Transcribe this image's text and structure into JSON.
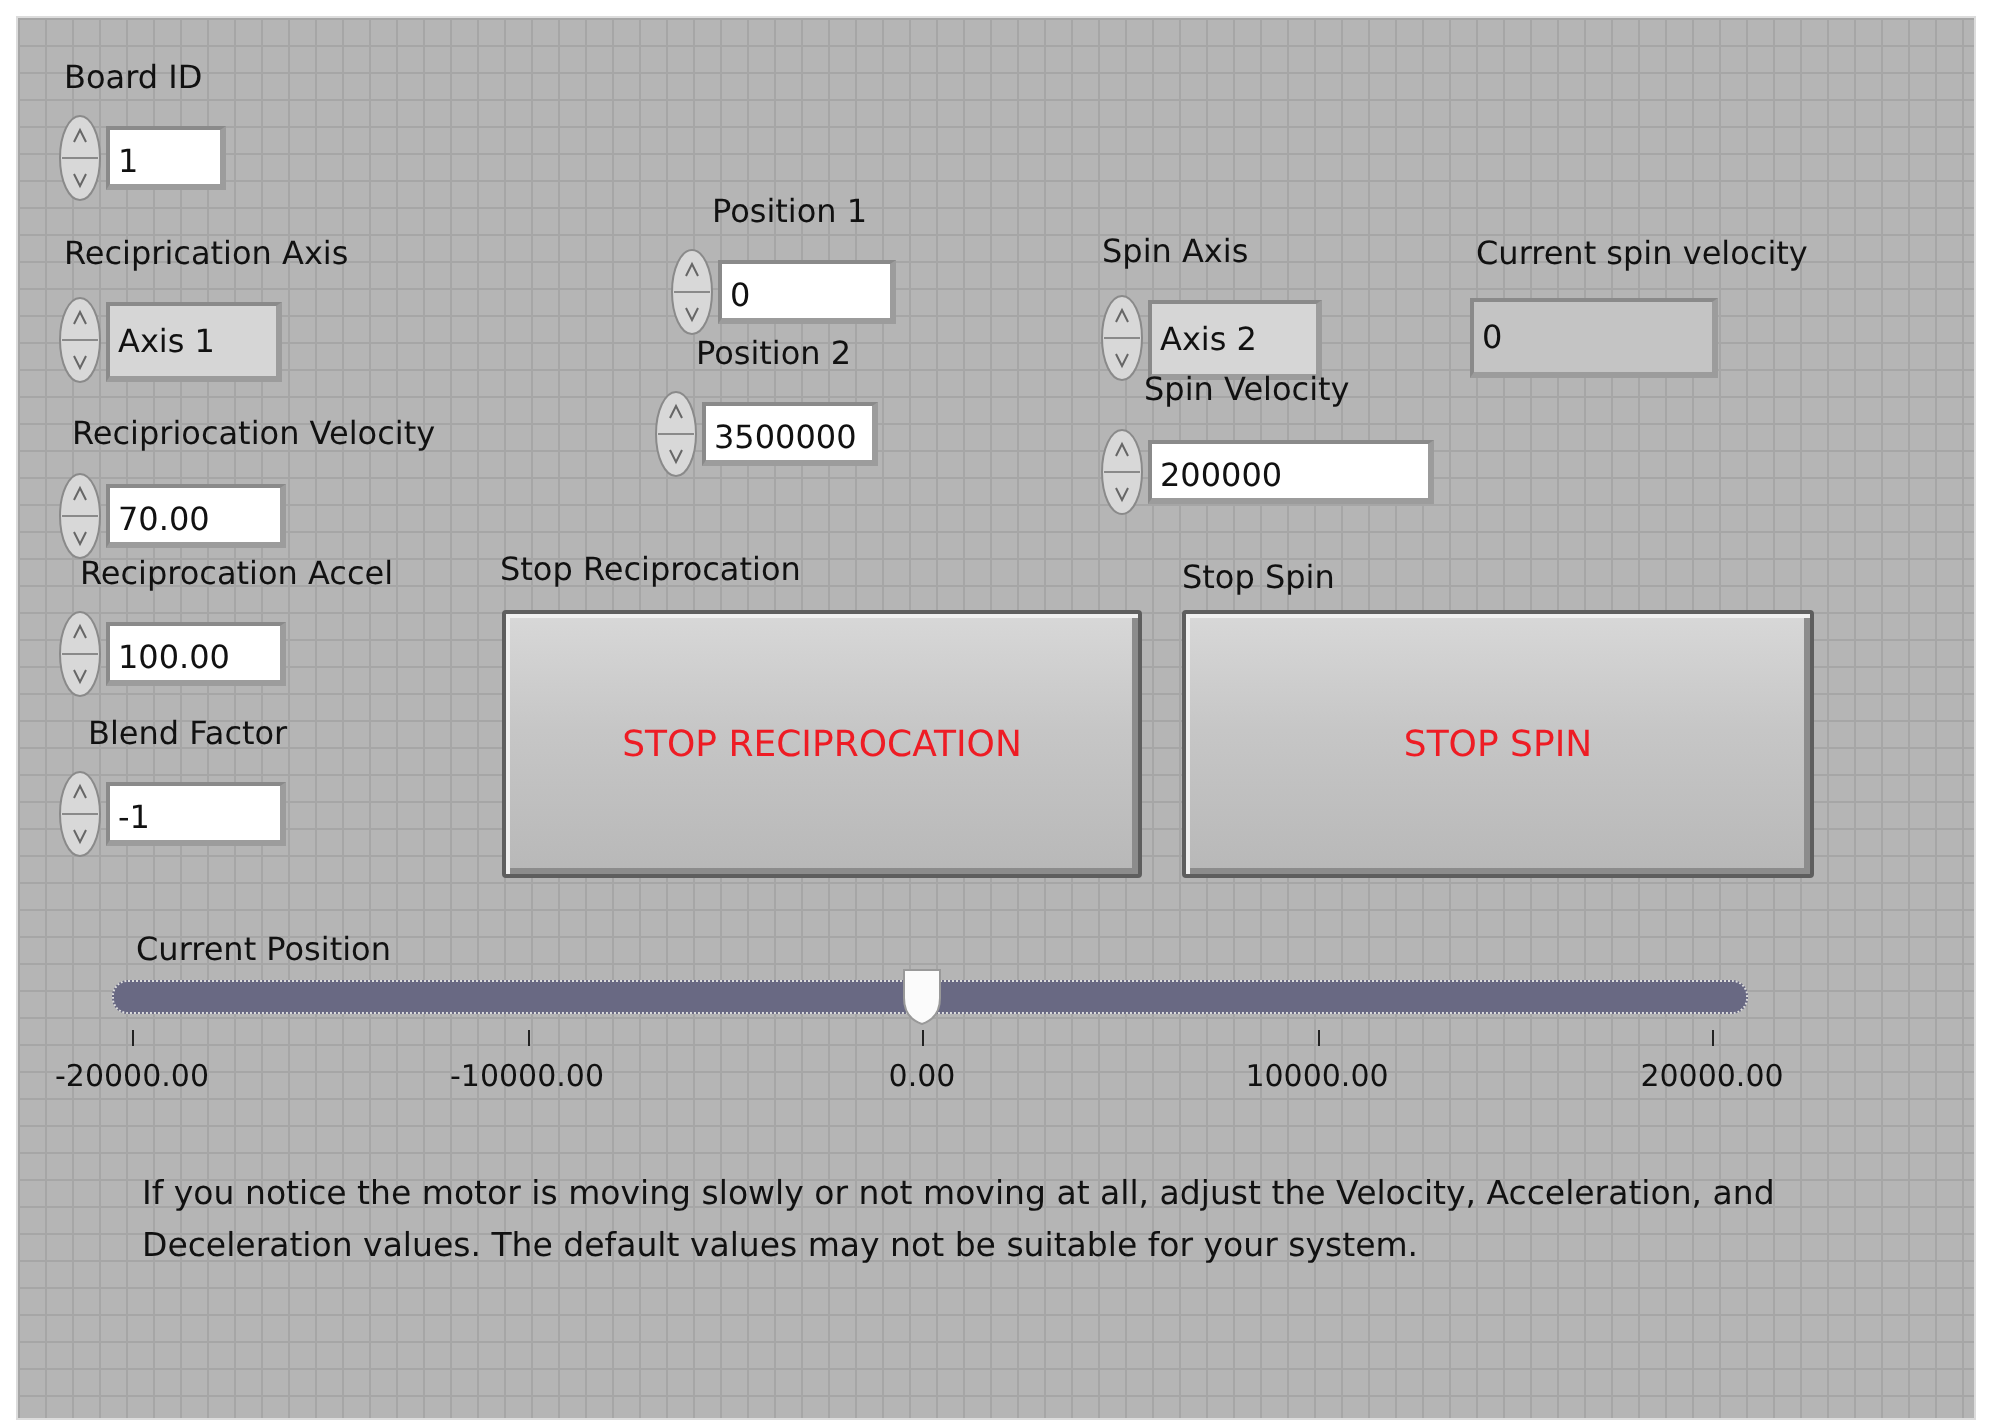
{
  "controls": [
    {
      "kind": "numeric",
      "label": "Board ID",
      "value": "1"
    },
    {
      "kind": "numeric",
      "label": "Position 1",
      "value": "0"
    },
    {
      "kind": "ring",
      "label": "Reciprication Axis",
      "value": "Axis 1"
    },
    {
      "kind": "ring",
      "label": "Spin Axis",
      "value": "Axis 2"
    },
    {
      "kind": "indicator",
      "label": "Current spin velocity",
      "value": "0"
    },
    {
      "kind": "numeric",
      "label": "Position 2",
      "value": "3500000"
    },
    {
      "kind": "numeric",
      "label": "Spin Velocity",
      "value": "200000"
    },
    {
      "kind": "numeric",
      "label": "Recipriocation Velocity",
      "value": "70.00"
    },
    {
      "kind": "numeric",
      "label": "Reciprocation Accel",
      "value": "100.00"
    },
    {
      "kind": "numeric",
      "label": "Blend Factor",
      "value": "-1"
    }
  ],
  "buttons": [
    {
      "label": "Stop Reciprocation",
      "text": "STOP RECIPROCATION"
    },
    {
      "label": "Stop Spin",
      "text": "STOP SPIN"
    }
  ],
  "slider": {
    "label": "Current Position",
    "level": 0.5,
    "ticks": [
      "-20000.00",
      "-10000.00",
      "0.00",
      "10000.00",
      "20000.00"
    ]
  },
  "note": "If you notice the motor is moving slowly or not moving at all, adjust the Velocity, Acceleration, and Deceleration values. The default values may not be suitable for your system."
}
